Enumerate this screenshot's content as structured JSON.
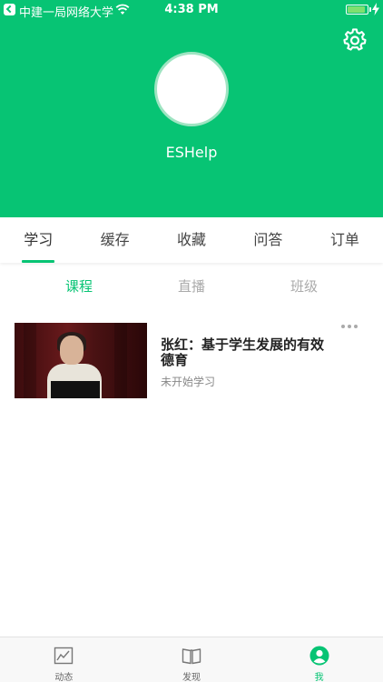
{
  "status_bar": {
    "carrier": "中建一局网络大学",
    "time": "4:38 PM",
    "battery_level": 0.9
  },
  "profile": {
    "username": "ESHelp",
    "settings_icon": "gear-icon"
  },
  "colors": {
    "brand_green": "#07c474",
    "text_dark": "#222222",
    "text_muted": "#888888"
  },
  "main_tabs": [
    {
      "label": "学习",
      "active": true
    },
    {
      "label": "缓存",
      "active": false
    },
    {
      "label": "收藏",
      "active": false
    },
    {
      "label": "问答",
      "active": false
    },
    {
      "label": "订单",
      "active": false
    }
  ],
  "sub_tabs": [
    {
      "label": "课程",
      "active": true
    },
    {
      "label": "直播",
      "active": false
    },
    {
      "label": "班级",
      "active": false
    }
  ],
  "courses": [
    {
      "title": "张红：基于学生发展的有效德育",
      "status": "未开始学习"
    }
  ],
  "bottom_nav": [
    {
      "label": "动态",
      "icon": "activity-chart-icon",
      "active": false
    },
    {
      "label": "发现",
      "icon": "book-icon",
      "active": false
    },
    {
      "label": "我",
      "icon": "user-icon",
      "active": true
    }
  ]
}
